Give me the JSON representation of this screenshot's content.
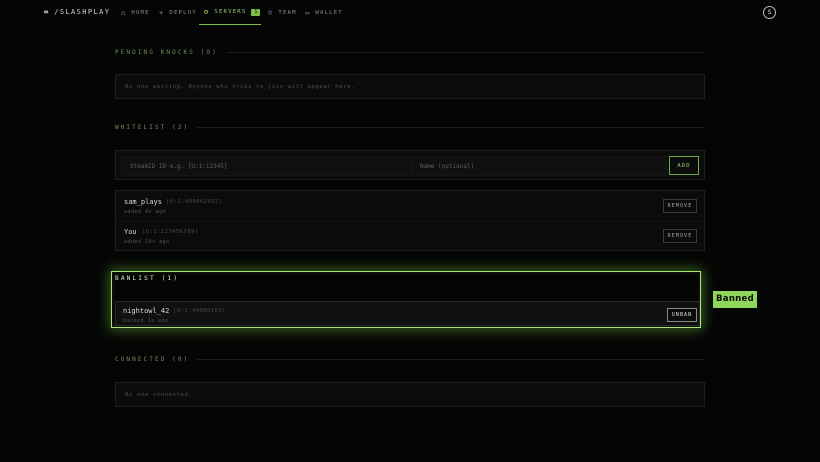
{
  "brand": {
    "logo": "∞",
    "name": "/SLASHPLAY"
  },
  "nav": {
    "tabs": [
      {
        "icon": "⌂",
        "label": "HOME"
      },
      {
        "icon": "+",
        "label": "DEPLOY"
      },
      {
        "icon": "⚙",
        "label": "SERVERS",
        "badge": "1"
      },
      {
        "icon": "☺",
        "label": "TEAM"
      },
      {
        "icon": "▭",
        "label": "WALLET"
      }
    ]
  },
  "user": {
    "initial": "S"
  },
  "pending": {
    "heading": "PENDING KNOCKS (0)",
    "empty": "No one waiting. Anyone who tries to join will appear here."
  },
  "whitelist": {
    "heading": "WHITELIST (2)",
    "steam_placeholder": "SteamID ID e.g. [U:1:12345]",
    "name_placeholder": "Name (optional)",
    "add_label": "ADD",
    "rows": [
      {
        "name": "sam_plays",
        "id": "[U:1:400002022]",
        "sub": "added 4s ago",
        "action": "REMOVE"
      },
      {
        "name": "You",
        "id": "[U:1:123456789]",
        "sub": "added 10s ago",
        "action": "REMOVE"
      }
    ]
  },
  "banlist": {
    "heading": "BANLIST (1)",
    "rows": [
      {
        "name": "nightowl_42",
        "id": "[U:1:40000101]",
        "sub": "banned 1s ago",
        "action": "UNBAN"
      }
    ]
  },
  "connected": {
    "heading": "CONNECTED (0)",
    "empty": "No one connected."
  },
  "callout": {
    "label": "Banned"
  },
  "colors": {
    "accent": "#7bbf49",
    "highlight": "#a9e878",
    "background": "#050505"
  }
}
